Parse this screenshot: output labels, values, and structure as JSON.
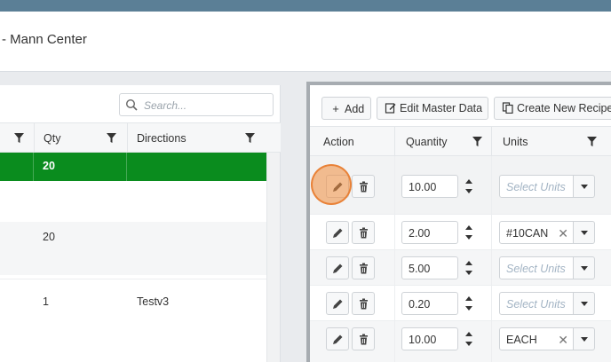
{
  "header": {
    "title": "- Mann Center"
  },
  "left": {
    "search_placeholder": "Search...",
    "columns": [
      "Qty",
      "Directions"
    ],
    "rows": [
      {
        "qty": "20",
        "directions": "",
        "highlight": true
      },
      {
        "qty": "20",
        "directions": ""
      },
      {
        "qty": "1",
        "directions": "Testv3"
      }
    ]
  },
  "right": {
    "toolbar": {
      "add_label": "Add",
      "edit_label": "Edit Master Data",
      "create_label": "Create New Recipe"
    },
    "columns": [
      "Action",
      "Quantity",
      "Units"
    ],
    "rows": [
      {
        "quantity": "10.00",
        "unit": "",
        "unit_placeholder": "Select Units"
      },
      {
        "quantity": "2.00",
        "unit": "#10CAN",
        "unit_placeholder": ""
      },
      {
        "quantity": "5.00",
        "unit": "",
        "unit_placeholder": "Select Units"
      },
      {
        "quantity": "0.20",
        "unit": "",
        "unit_placeholder": "Select Units"
      },
      {
        "quantity": "10.00",
        "unit": "EACH",
        "unit_placeholder": ""
      }
    ]
  },
  "icons": {
    "search": "search-icon",
    "filter": "filter-icon",
    "edit": "pencil-icon",
    "delete": "trash-icon",
    "spinner": "spinner-arrows-icon",
    "clear": "close-icon",
    "dropdown": "caret-down-icon"
  },
  "colors": {
    "topbar": "#5b7f96",
    "highlight_row": "#0a8c1e",
    "cursor": "#f08c3c"
  }
}
